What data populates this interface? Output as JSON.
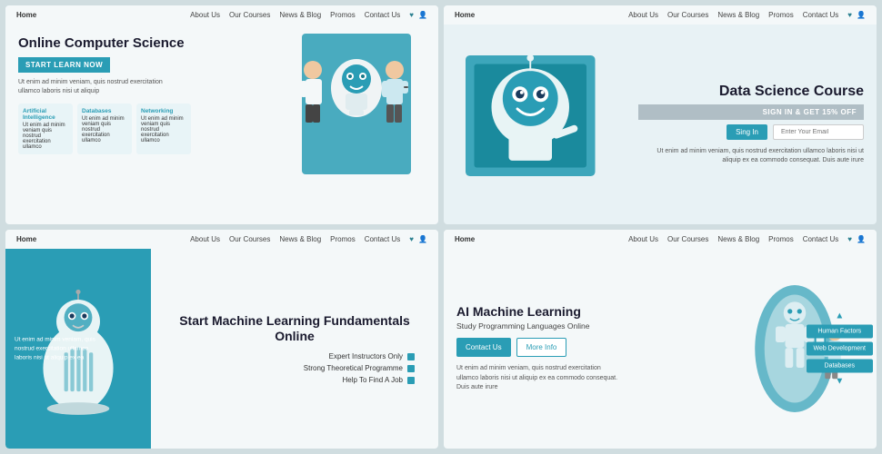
{
  "panels": [
    {
      "id": "panel-1",
      "nav": {
        "home": "Home",
        "items": [
          "About Us",
          "Our Courses",
          "News & Blog",
          "Promos",
          "Contact Us"
        ]
      },
      "title": "Online Computer Science",
      "cta": "START LEARN NOW",
      "desc": "Ut enim ad minim veniam, quis nostrud exercitation ullamco laboris nisi ut aliquip",
      "cards": [
        {
          "title": "Artificial Intelligence",
          "desc": "Ut enim ad minim veniam quis nostrud exercitation ullamco"
        },
        {
          "title": "Databases",
          "desc": "Ut enim ad minim veniam quis nostrud exercitation ullamco"
        },
        {
          "title": "Networking",
          "desc": "Ut enim ad minim veniam quis nostrud exercitation ullamco"
        }
      ]
    },
    {
      "id": "panel-2",
      "nav": {
        "home": "Home",
        "items": [
          "About Us",
          "Our Courses",
          "News & Blog",
          "Promos",
          "Contact Us"
        ]
      },
      "title": "Data Science Course",
      "cta": "SIGN IN & GET 15% OFF",
      "sign_btn": "Sing In",
      "email_placeholder": "Enter Your Email",
      "desc": "Ut enim ad minim veniam, quis nostrud exercitation ullamco laboris nisi ut aliquip ex ea commodo consequat. Duis aute irure"
    },
    {
      "id": "panel-3",
      "nav": {
        "home": "Home",
        "items": [
          "About Us",
          "Our Courses",
          "News & Blog",
          "Promos",
          "Contact Us"
        ]
      },
      "title": "Start Machine Learning Fundamentals Online",
      "left_text": "Ut enim ad minim veniam, quis nostrud exercitation ullamco laboris nisi ut aliquip ex ea",
      "features": [
        "Expert Instructors Only",
        "Strong Theoretical Programme",
        "Help To Find A Job"
      ]
    },
    {
      "id": "panel-4",
      "nav": {
        "home": "Home",
        "items": [
          "About Us",
          "Our Courses",
          "News & Blog",
          "Promos",
          "Contact Us"
        ]
      },
      "title": "AI Machine Learning",
      "subtitle": "Study Programming Languages Online",
      "btn1": "Contact Us",
      "btn2": "More Info",
      "desc": "Ut enim ad minim veniam, quis nostrud exercitation ullamco laboris nisi ut aliquip ex ea commodo consequat. Duis aute irure",
      "tags": [
        "Human Factors",
        "Web Development",
        "Databases"
      ]
    }
  ]
}
